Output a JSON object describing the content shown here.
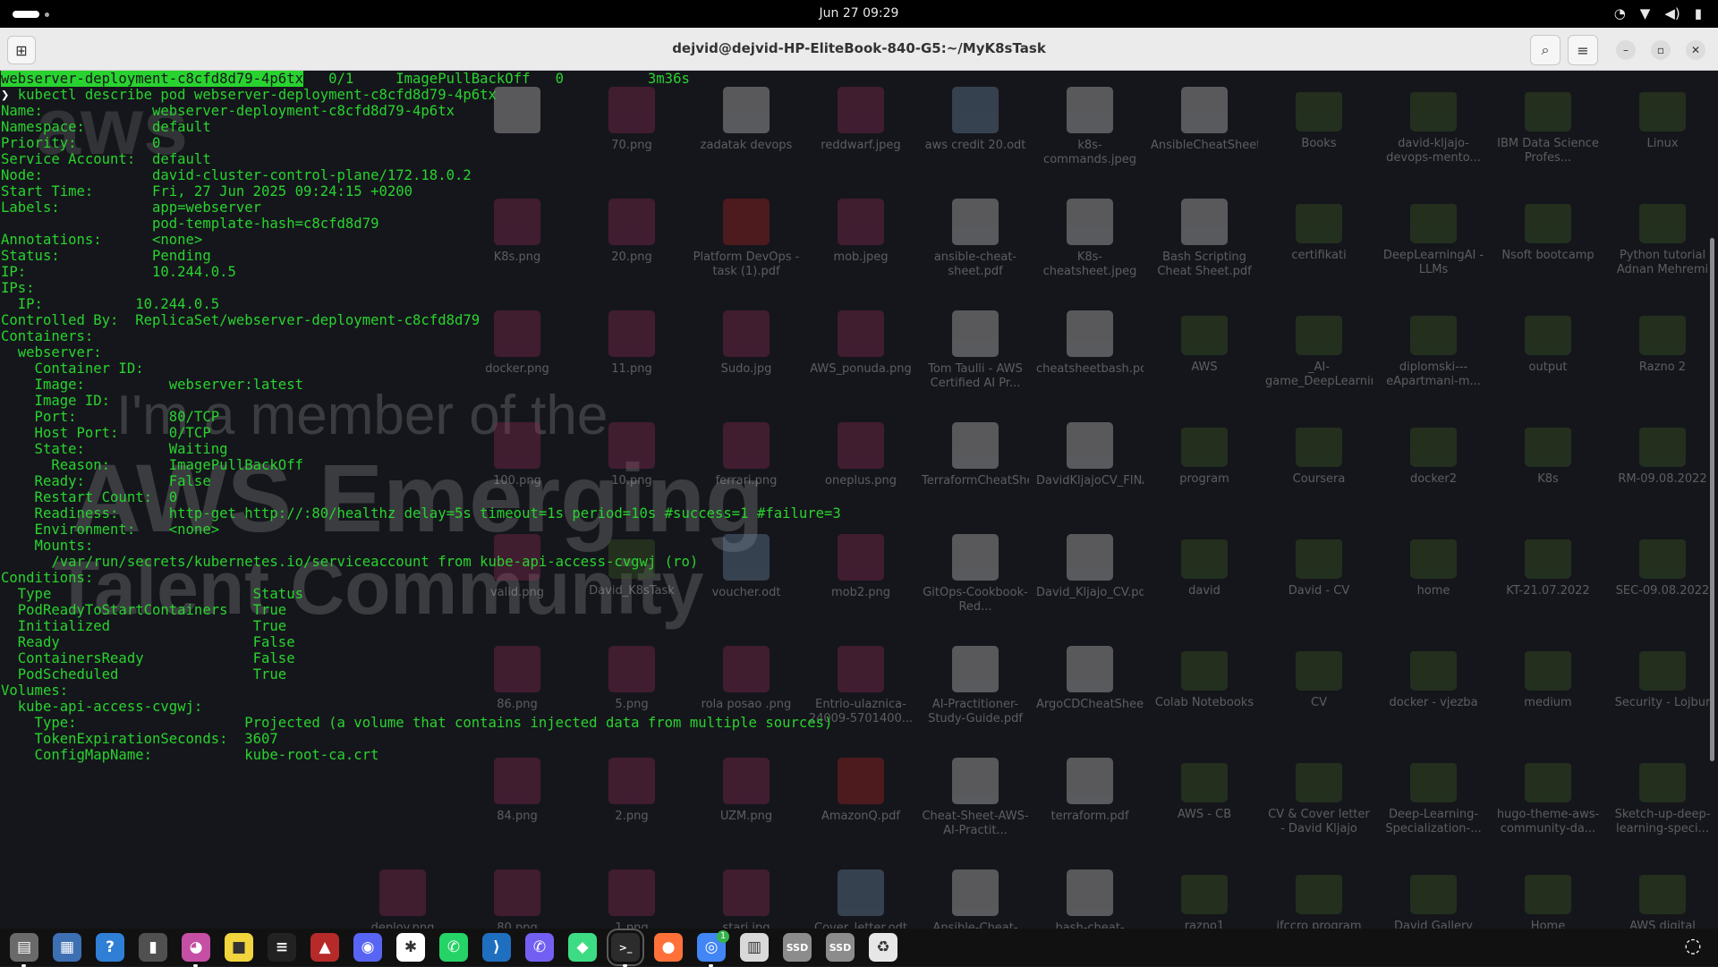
{
  "topbar": {
    "clock": "Jun 27  09:29",
    "tray_icons": [
      "whatsapp-tray-icon",
      "wifi-icon",
      "volume-icon",
      "battery-icon"
    ]
  },
  "window": {
    "title": "dejvid@dejvid-HP-EliteBook-840-G5:~/MyK8sTask",
    "buttons": [
      "new-tab",
      "search",
      "menu",
      "minimize",
      "maximize",
      "close"
    ]
  },
  "terminal": {
    "lines": [
      {
        "hl": "webserver-deployment-c8cfd8d79-4p6tx",
        "t": "   0/1     ImagePullBackOff   0          3m36s"
      },
      {
        "prompt": "❯",
        "t": " kubectl describe pod webserver-deployment-c8cfd8d79-4p6tx"
      },
      {
        "t": "Name:             webserver-deployment-c8cfd8d79-4p6tx"
      },
      {
        "t": "Namespace:        default"
      },
      {
        "t": "Priority:         0"
      },
      {
        "t": "Service Account:  default"
      },
      {
        "t": "Node:             david-cluster-control-plane/172.18.0.2"
      },
      {
        "t": "Start Time:       Fri, 27 Jun 2025 09:24:15 +0200"
      },
      {
        "t": "Labels:           app=webserver"
      },
      {
        "t": "                  pod-template-hash=c8cfd8d79"
      },
      {
        "t": "Annotations:      <none>"
      },
      {
        "t": "Status:           Pending"
      },
      {
        "t": "IP:               10.244.0.5"
      },
      {
        "t": "IPs:"
      },
      {
        "t": "  IP:           10.244.0.5"
      },
      {
        "t": "Controlled By:  ReplicaSet/webserver-deployment-c8cfd8d79"
      },
      {
        "t": "Containers:"
      },
      {
        "t": "  webserver:"
      },
      {
        "t": "    Container ID:"
      },
      {
        "t": "    Image:          webserver:latest"
      },
      {
        "t": "    Image ID:"
      },
      {
        "t": "    Port:           80/TCP"
      },
      {
        "t": "    Host Port:      0/TCP"
      },
      {
        "t": "    State:          Waiting"
      },
      {
        "t": "      Reason:       ImagePullBackOff"
      },
      {
        "t": "    Ready:          False"
      },
      {
        "t": "    Restart Count:  0"
      },
      {
        "t": "    Readiness:      http-get http://:80/healthz delay=5s timeout=1s period=10s #success=1 #failure=3"
      },
      {
        "t": "    Environment:    <none>"
      },
      {
        "t": "    Mounts:"
      },
      {
        "t": "      /var/run/secrets/kubernetes.io/serviceaccount from kube-api-access-cvgwj (ro)"
      },
      {
        "t": "Conditions:"
      },
      {
        "t": "  Type                        Status"
      },
      {
        "t": "  PodReadyToStartContainers   True"
      },
      {
        "t": "  Initialized                 True"
      },
      {
        "t": "  Ready                       False"
      },
      {
        "t": "  ContainersReady             False"
      },
      {
        "t": "  PodScheduled                True"
      },
      {
        "t": "Volumes:"
      },
      {
        "t": "  kube-api-access-cvgwj:"
      },
      {
        "t": "    Type:                    Projected (a volume that contains injected data from multiple sources)"
      },
      {
        "t": "    TokenExpirationSeconds:  3607"
      },
      {
        "t": "    ConfigMapName:           kube-root-ca.crt"
      }
    ]
  },
  "desktop": {
    "wallpaper": [
      "I'm a member of the",
      "AWS Emerging",
      "Talent Community"
    ],
    "icons": [
      {
        "name": "",
        "kind": "doc"
      },
      {
        "name": "70.png",
        "kind": "img"
      },
      {
        "name": "zadatak devops",
        "kind": "doc"
      },
      {
        "name": "reddwarf.jpeg",
        "kind": "img"
      },
      {
        "name": "aws credit 20.odt",
        "kind": "odt"
      },
      {
        "name": "k8s-commands.jpeg",
        "kind": "doc"
      },
      {
        "name": "AnsibleCheatSheet.pdf",
        "kind": "doc"
      },
      {
        "name": "Books",
        "kind": "folder"
      },
      {
        "name": "david-kljajo-devops-mento...",
        "kind": "folder"
      },
      {
        "name": "IBM Data Science Profes...",
        "kind": "folder"
      },
      {
        "name": "Linux",
        "kind": "folder"
      },
      {
        "name": "K8s.png",
        "kind": "img"
      },
      {
        "name": "20.png",
        "kind": "img"
      },
      {
        "name": "Platform DevOps - task (1).pdf",
        "kind": "pdf"
      },
      {
        "name": "mob.jpeg",
        "kind": "img"
      },
      {
        "name": "ansible-cheat-sheet.pdf",
        "kind": "doc"
      },
      {
        "name": "K8s-cheatsheet.jpeg",
        "kind": "doc"
      },
      {
        "name": "Bash Scripting Cheat Sheet.pdf",
        "kind": "doc"
      },
      {
        "name": "certifikati",
        "kind": "folder"
      },
      {
        "name": "DeepLearningAI - LLMs",
        "kind": "folder"
      },
      {
        "name": "Nsoft bootcamp",
        "kind": "folder"
      },
      {
        "name": "Python tutorial Adnan Mehremi",
        "kind": "folder"
      },
      {
        "name": "docker.png",
        "kind": "img"
      },
      {
        "name": "11.png",
        "kind": "img"
      },
      {
        "name": "Sudo.jpg",
        "kind": "img"
      },
      {
        "name": "AWS_ponuda.png",
        "kind": "img"
      },
      {
        "name": "Tom Taulli - AWS Certified AI Pr...",
        "kind": "doc"
      },
      {
        "name": "cheatsheetbash.pdf",
        "kind": "doc"
      },
      {
        "name": "AWS",
        "kind": "folder"
      },
      {
        "name": "_AI-game_DeepLearningAI",
        "kind": "folder"
      },
      {
        "name": "diplomski---eApartmani-m...",
        "kind": "folder"
      },
      {
        "name": "output",
        "kind": "folder"
      },
      {
        "name": "Razno 2",
        "kind": "folder"
      },
      {
        "name": "100.png",
        "kind": "img"
      },
      {
        "name": "10.png",
        "kind": "img"
      },
      {
        "name": "ferrari.png",
        "kind": "img"
      },
      {
        "name": "oneplus.png",
        "kind": "img"
      },
      {
        "name": "TerraformCheatSheetSpacelift...",
        "kind": "doc"
      },
      {
        "name": "DavidKljajoCV_FINAL.pdf",
        "kind": "doc"
      },
      {
        "name": "program",
        "kind": "folder"
      },
      {
        "name": "Coursera",
        "kind": "folder"
      },
      {
        "name": "docker2",
        "kind": "folder"
      },
      {
        "name": "K8s",
        "kind": "folder"
      },
      {
        "name": "RM-09.08.2022",
        "kind": "folder"
      },
      {
        "name": "valid.png",
        "kind": "img"
      },
      {
        "name": "David_K8sTask",
        "kind": "folder"
      },
      {
        "name": "voucher.odt",
        "kind": "odt"
      },
      {
        "name": "mob2.png",
        "kind": "img"
      },
      {
        "name": "GitOps-Cookbook-Red...",
        "kind": "doc"
      },
      {
        "name": "David_Kljajo_CV.pdf",
        "kind": "doc"
      },
      {
        "name": "david",
        "kind": "folder"
      },
      {
        "name": "David - CV",
        "kind": "folder"
      },
      {
        "name": "home",
        "kind": "folder"
      },
      {
        "name": "KT-21.07.2022",
        "kind": "folder"
      },
      {
        "name": "SEC-09.08.2022",
        "kind": "folder"
      },
      {
        "name": "86.png",
        "kind": "img"
      },
      {
        "name": "5.png",
        "kind": "img"
      },
      {
        "name": "rola posao .png",
        "kind": "img"
      },
      {
        "name": "Entrio-ulaznica-24009-5701400...",
        "kind": "img"
      },
      {
        "name": "AI-Practitioner-Study-Guide.pdf",
        "kind": "doc"
      },
      {
        "name": "ArgoCDCheatSheet.pdf",
        "kind": "doc"
      },
      {
        "name": "Colab Notebooks",
        "kind": "folder"
      },
      {
        "name": "CV",
        "kind": "folder"
      },
      {
        "name": "docker - vjezba",
        "kind": "folder"
      },
      {
        "name": "medium",
        "kind": "folder"
      },
      {
        "name": "Security - Lojbur",
        "kind": "folder"
      },
      {
        "name": "84.png",
        "kind": "img"
      },
      {
        "name": "2.png",
        "kind": "img"
      },
      {
        "name": "UZM.png",
        "kind": "img"
      },
      {
        "name": "AmazonQ.pdf",
        "kind": "pdf"
      },
      {
        "name": "Cheat-Sheet-AWS-AI-Practit...",
        "kind": "doc"
      },
      {
        "name": "terraform.pdf",
        "kind": "doc"
      },
      {
        "name": "AWS - CB",
        "kind": "folder"
      },
      {
        "name": "CV & Cover letter - David Kljajo",
        "kind": "folder"
      },
      {
        "name": "Deep-Learning-Specialization-...",
        "kind": "folder"
      },
      {
        "name": "hugo-theme-aws-community-da...",
        "kind": "folder"
      },
      {
        "name": "Sketch-up-deep-learning-speci...",
        "kind": "folder"
      }
    ],
    "bottom_icons": [
      {
        "name": "deploy.png",
        "kind": "img"
      },
      {
        "name": "80.png",
        "kind": "img"
      },
      {
        "name": "1.png",
        "kind": "img"
      },
      {
        "name": "stari.jpg",
        "kind": "img"
      },
      {
        "name": "Cover_letter.odt",
        "kind": "odt"
      },
      {
        "name": "Ansible-Cheat-Sheet.pdf",
        "kind": "doc"
      },
      {
        "name": "bash-cheat-sheet.pdf",
        "kind": "doc"
      },
      {
        "name": "razno1",
        "kind": "folder"
      },
      {
        "name": "ifccro program",
        "kind": "folder"
      },
      {
        "name": "David Gallery",
        "kind": "folder"
      },
      {
        "name": "Home",
        "kind": "folder"
      },
      {
        "name": "AWS digital badges",
        "kind": "folder"
      }
    ]
  },
  "dock": {
    "items": [
      {
        "name": "files-app",
        "color": "#6a6a6a",
        "glyph": "▤",
        "running": true
      },
      {
        "name": "text-editor-app",
        "color": "#3d6fb3",
        "glyph": "▦",
        "running": false
      },
      {
        "name": "help-app",
        "color": "#2f7fd6",
        "glyph": "?",
        "running": false
      },
      {
        "name": "document-app",
        "color": "#505050",
        "glyph": "▮",
        "running": false
      },
      {
        "name": "color-picker-app",
        "color": "#c44fa5",
        "glyph": "◕",
        "running": true
      },
      {
        "name": "notes-app",
        "color": "#f2d43c",
        "glyph": "■",
        "running": false
      },
      {
        "name": "terminal-alt-app",
        "color": "#222222",
        "glyph": "≡",
        "running": false
      },
      {
        "name": "game-app",
        "color": "#b62a2a",
        "glyph": "▲",
        "running": false
      },
      {
        "name": "discord-app",
        "color": "#5865f2",
        "glyph": "◉",
        "running": false
      },
      {
        "name": "slack-app",
        "color": "#ffffff",
        "glyph": "✱",
        "running": false
      },
      {
        "name": "whatsapp-app",
        "color": "#25d366",
        "glyph": "✆",
        "running": false
      },
      {
        "name": "vscode-app",
        "color": "#1f6fc0",
        "glyph": "⟩",
        "running": false
      },
      {
        "name": "viber-app",
        "color": "#7360f2",
        "glyph": "✆",
        "running": false
      },
      {
        "name": "android-studio-app",
        "color": "#3ddc84",
        "glyph": "◆",
        "running": false
      },
      {
        "name": "terminal-app",
        "color": "#2c2c2c",
        "glyph": ">_",
        "running": true,
        "active": true
      },
      {
        "name": "firefox-app",
        "color": "#ff7139",
        "glyph": "●",
        "running": false
      },
      {
        "name": "chrome-app",
        "color": "#4285f4",
        "glyph": "◎",
        "running": true
      },
      {
        "name": "system-monitor-app",
        "color": "#d9d9d9",
        "glyph": "▥",
        "running": false
      },
      {
        "name": "ssd-drive-1",
        "color": "#8c8c8c",
        "glyph": "SSD",
        "running": false
      },
      {
        "name": "ssd-drive-2",
        "color": "#8c8c8c",
        "glyph": "SSD",
        "running": false
      },
      {
        "name": "trash-app",
        "color": "#e7e7e7",
        "glyph": "♻",
        "running": false
      }
    ],
    "chrome_badge": "1"
  }
}
